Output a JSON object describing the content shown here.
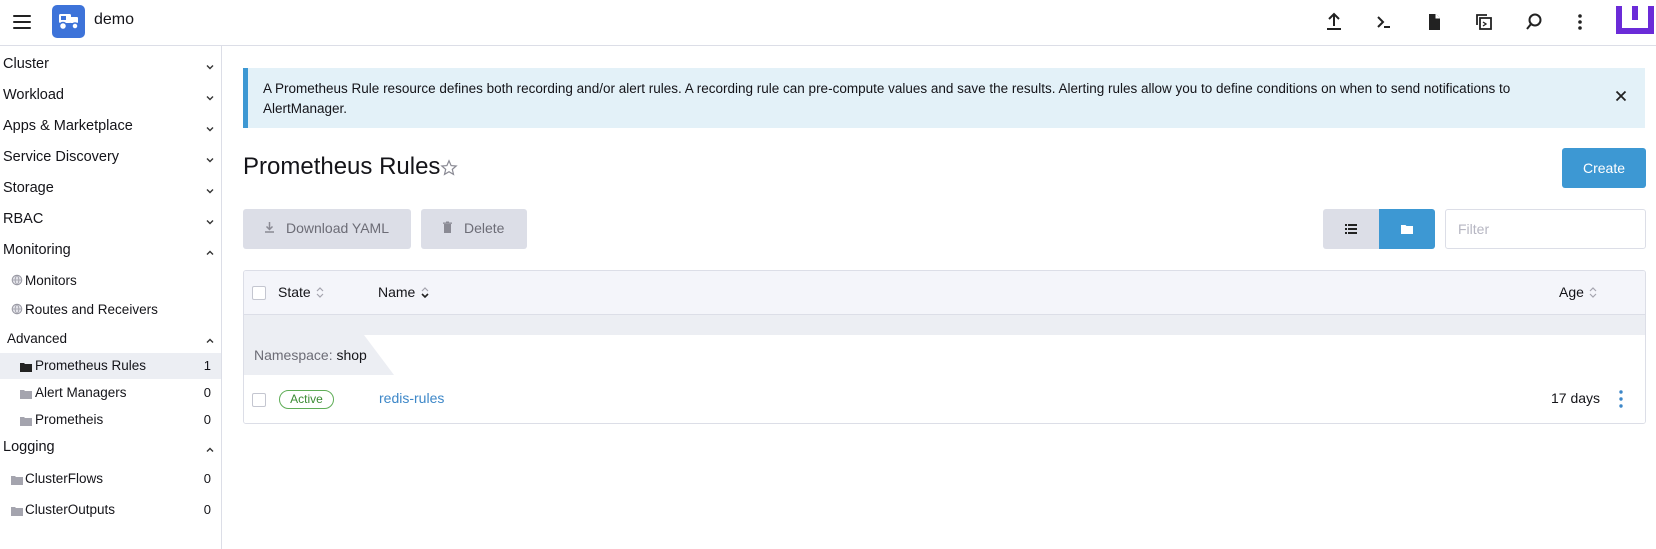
{
  "header": {
    "app_title": "demo",
    "icons": [
      "menu-icon",
      "app-logo",
      "upload-icon",
      "terminal-icon",
      "file-icon",
      "copy-config-icon",
      "search-icon",
      "more-vertical-icon",
      "user-avatar"
    ]
  },
  "sidebar": {
    "groups": {
      "cluster": "Cluster",
      "workload": "Workload",
      "apps": "Apps & Marketplace",
      "service_discovery": "Service Discovery",
      "storage": "Storage",
      "rbac": "RBAC",
      "monitoring": "Monitoring",
      "logging": "Logging"
    },
    "monitoring_items": {
      "monitors": "Monitors",
      "routes": "Routes and Receivers",
      "advanced": "Advanced"
    },
    "advanced_items": [
      {
        "label": "Prometheus Rules",
        "count": "1"
      },
      {
        "label": "Alert Managers",
        "count": "0"
      },
      {
        "label": "Prometheis",
        "count": "0"
      }
    ],
    "logging_items": [
      {
        "label": "ClusterFlows",
        "count": "0"
      },
      {
        "label": "ClusterOutputs",
        "count": "0"
      }
    ]
  },
  "banner": {
    "text": "A Prometheus Rule resource defines both recording and/or alert rules. A recording rule can pre-compute values and save the results. Alerting rules allow you to define conditions on when to send notifications to AlertManager."
  },
  "page": {
    "title": "Prometheus Rules",
    "create_label": "Create",
    "download_label": "Download YAML",
    "delete_label": "Delete",
    "filter_placeholder": "Filter"
  },
  "table": {
    "headers": {
      "state": "State",
      "name": "Name",
      "age": "Age"
    },
    "group": {
      "prefix": "Namespace:",
      "value": "shop"
    },
    "rows": [
      {
        "state": "Active",
        "name": "redis-rules",
        "age": "17 days"
      }
    ]
  },
  "colors": {
    "accent": "#3d98d3",
    "logo": "#3d73d9",
    "active_badge": "#5fad57",
    "avatar": "#6b2bd8"
  }
}
